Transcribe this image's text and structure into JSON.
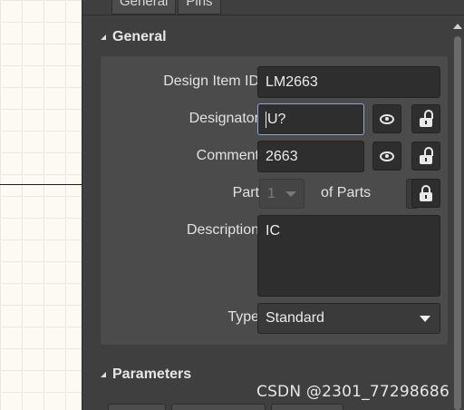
{
  "tabs": [
    {
      "label": "General"
    },
    {
      "label": "Pins"
    }
  ],
  "general": {
    "title": "General",
    "design_item_id": {
      "label": "Design Item ID",
      "value": "LM2663"
    },
    "designator": {
      "label": "Designator",
      "value": "U?"
    },
    "comment": {
      "label": "Comment",
      "value": "2663"
    },
    "part": {
      "label": "Part",
      "value": "1",
      "of_parts_label": "of Parts"
    },
    "description": {
      "label": "Description",
      "value": "IC"
    },
    "type": {
      "label": "Type",
      "value": "Standard"
    }
  },
  "parameters": {
    "title": "Parameters"
  },
  "watermark": "CSDN @2301_77298686",
  "colors": {
    "panel_bg": "#3f3f3f",
    "group_bg": "#4b4b4b",
    "field_bg": "#2e2e2e",
    "focus_border": "#8aa8cc"
  }
}
